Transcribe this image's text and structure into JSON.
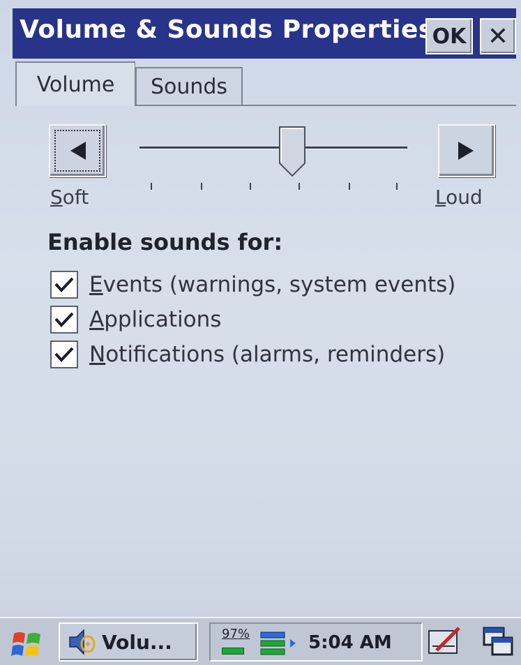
{
  "titlebar": {
    "title": "Volume & Sounds Properties",
    "ok_label": "OK",
    "close_label": "✕"
  },
  "tabs": [
    {
      "label": "Volume",
      "active": true
    },
    {
      "label": "Sounds",
      "active": false
    }
  ],
  "volume": {
    "soft_label": "Soft",
    "soft_key": "S",
    "loud_label": "Loud",
    "loud_key": "L",
    "level_fraction": 0.57
  },
  "sounds_section": {
    "heading": "Enable sounds for:",
    "options": [
      {
        "key": "E",
        "rest": "vents (warnings, system events)",
        "checked": true
      },
      {
        "key": "A",
        "rest": "pplications",
        "checked": true
      },
      {
        "key": "N",
        "rest": "otifications (alarms, reminders)",
        "checked": true
      }
    ]
  },
  "taskbar": {
    "task_label": "Volu...",
    "battery_percent": "97%",
    "clock": "5:04 AM"
  },
  "colors": {
    "titlebar": "#28338a",
    "battery": "#1ea83a"
  }
}
